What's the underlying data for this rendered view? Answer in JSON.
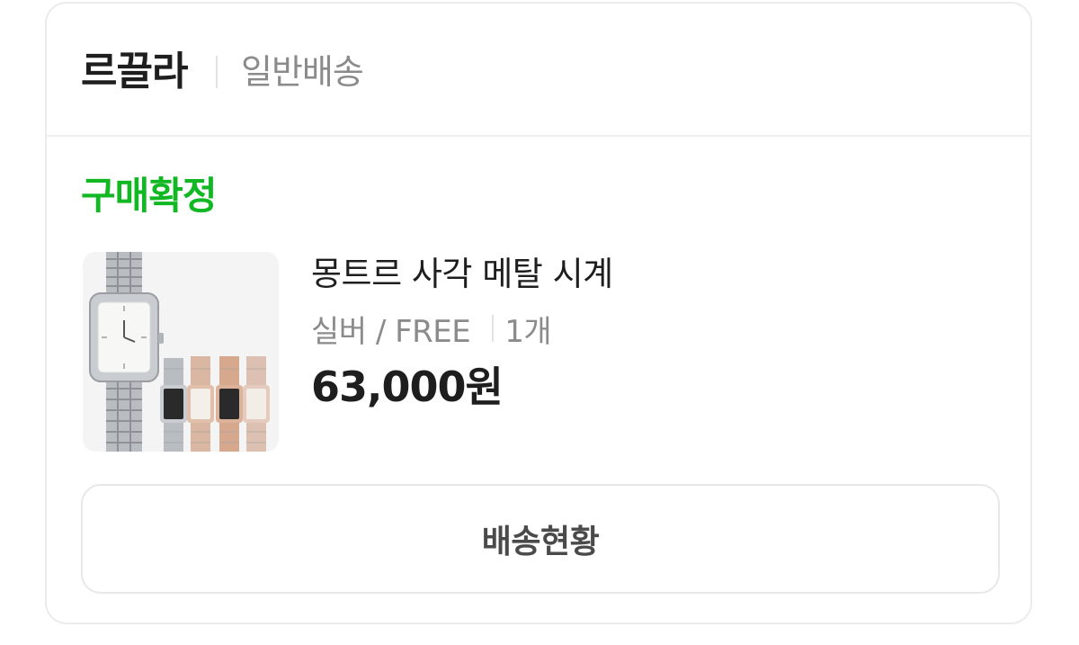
{
  "order": {
    "seller_name": "르끌라",
    "shipping_type": "일반배송",
    "status": "구매확정",
    "product": {
      "name": "몽트르 사각 메탈 시계",
      "option": "실버 / FREE",
      "quantity": "1개",
      "price": "63,000원",
      "image": "watch-product-thumbnail"
    },
    "track_button_label": "배송현황"
  },
  "colors": {
    "status": "#12b823",
    "text_primary": "#1e1e1e",
    "text_secondary": "#8b8b8b",
    "border": "#ececec"
  }
}
